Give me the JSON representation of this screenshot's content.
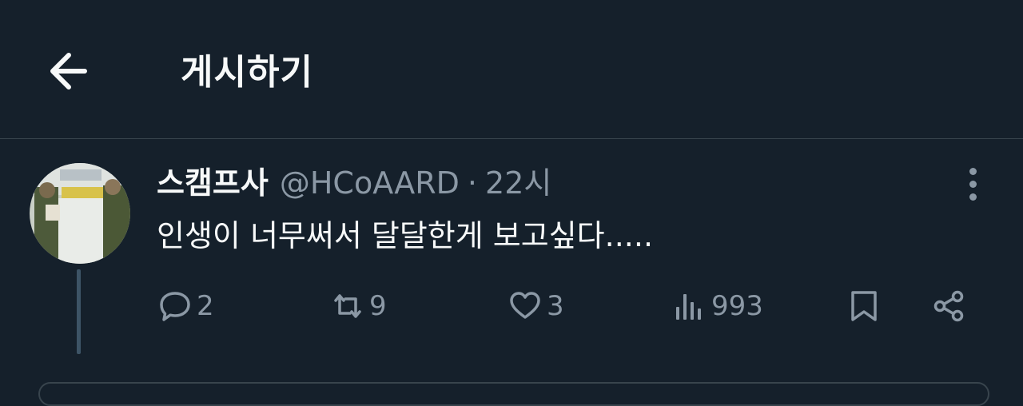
{
  "header": {
    "title": "게시하기"
  },
  "tweet": {
    "display_name": "스캠프사",
    "handle": "@HCoAARD",
    "separator": "·",
    "time": "22시",
    "text": "인생이 너무써서 달달한게 보고싶다....."
  },
  "actions": {
    "replies": "2",
    "retweets": "9",
    "likes": "3",
    "views": "993"
  },
  "icons": {
    "back": "arrow-left-icon",
    "more": "more-vertical-icon",
    "reply": "speech-bubble-icon",
    "retweet": "retweet-icon",
    "like": "heart-icon",
    "views": "bar-chart-icon",
    "bookmark": "bookmark-icon",
    "share": "share-icon"
  },
  "colors": {
    "background": "#15202b",
    "text": "#f7f9f9",
    "muted": "#8b98a5",
    "divider": "#38444d"
  }
}
